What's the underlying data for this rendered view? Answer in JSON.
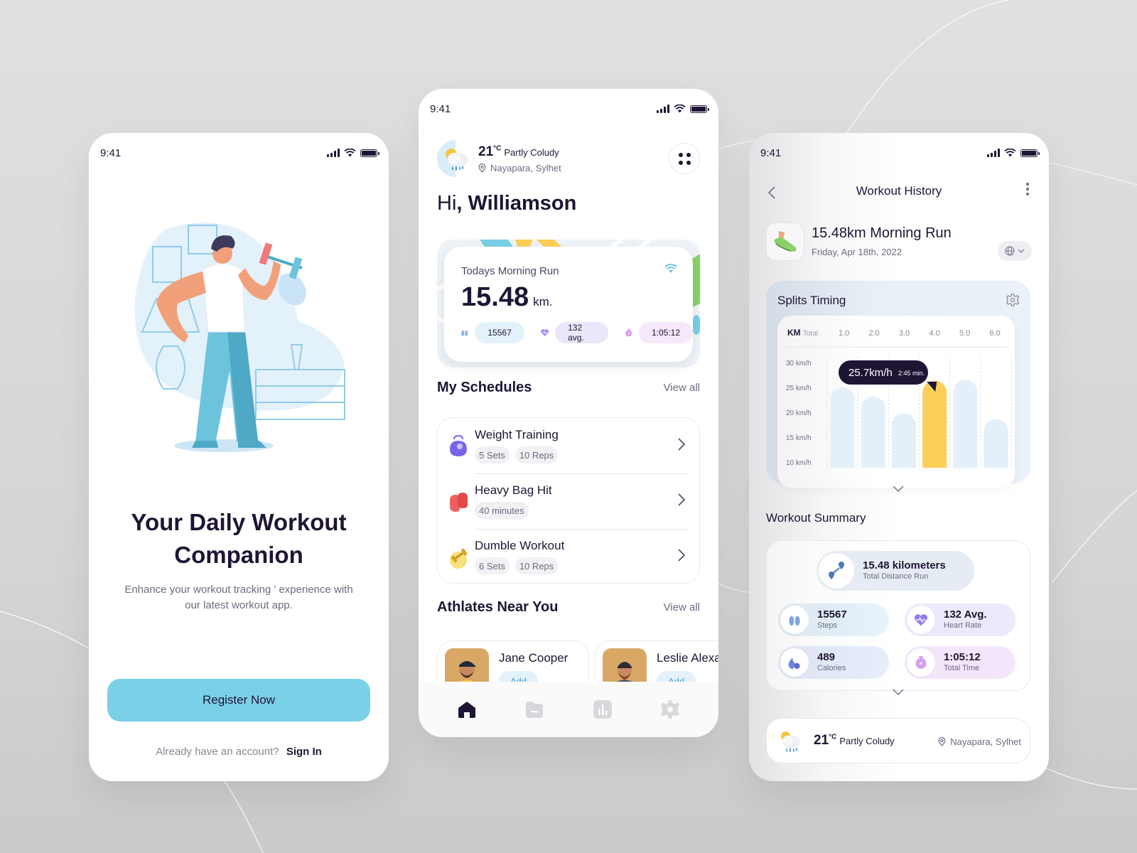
{
  "status_bar": {
    "time": "9:41"
  },
  "onboarding": {
    "title_line1": "Your Daily Workout",
    "title_line2": "Companion",
    "subtitle_line1": "Enhance your workout tracking ' experience with",
    "subtitle_line2": "our latest workout app.",
    "register_button": "Register Now",
    "signin_prompt": "Already have an account?",
    "signin_link": "Sign In"
  },
  "home": {
    "weather": {
      "temp": "21",
      "unit": "°C",
      "condition": "Partly Coludy",
      "location": "Nayapara, Sylhet"
    },
    "greeting_prefix": "Hi",
    "greeting_name": ", Williamson",
    "run_card": {
      "label": "Todays Morning Run",
      "distance": "15.48",
      "unit": "km.",
      "steps": "15567",
      "heart_rate": "132 avg.",
      "duration": "1:05:12"
    },
    "schedules": {
      "title": "My Schedules",
      "view_all": "View all",
      "items": [
        {
          "name": "Weight Training",
          "tags": [
            "5 Sets",
            "10 Reps"
          ],
          "icon": "kettlebell-icon"
        },
        {
          "name": "Heavy Bag Hit",
          "tags": [
            "40 minutes"
          ],
          "icon": "boxing-gloves-icon"
        },
        {
          "name": "Dumble Workout",
          "tags": [
            "6 Sets",
            "10 Reps"
          ],
          "icon": "dumbbell-icon"
        }
      ]
    },
    "athletes": {
      "title": "Athlates Near You",
      "view_all": "View all",
      "items": [
        {
          "name": "Jane Cooper",
          "action": "Add"
        },
        {
          "name": "Leslie Alexander",
          "action": "Add"
        }
      ]
    },
    "tabbar": [
      "home-icon",
      "folder-icon",
      "stats-icon",
      "settings-icon"
    ]
  },
  "history": {
    "title": "Workout History",
    "run_title": "15.48km Morning Run",
    "run_date": "Friday, Apr 18th, 2022",
    "splits": {
      "title": "Splits Timing",
      "tooltip_speed": "25.7km/h",
      "tooltip_time": "2:45 min."
    },
    "summary": {
      "title": "Workout Summary",
      "distance_value": "15.48 kilometers",
      "distance_label": "Total Distance Run",
      "steps_value": "15567",
      "steps_label": "Steps",
      "heart_value": "132 Avg.",
      "heart_label": "Heart Rate",
      "calories_value": "489",
      "calories_label": "Calories",
      "time_value": "1:05:12",
      "time_label": "Total Time"
    },
    "weather": {
      "temp": "21",
      "unit": "°C",
      "condition": "Partly Coludy",
      "location": "Nayapara, Sylhet"
    }
  },
  "chart_data": {
    "type": "bar",
    "title": "Splits Timing",
    "header_label": "KM",
    "header_sub": "Total",
    "categories": [
      "1.0",
      "2.0",
      "3.0",
      "4.0",
      "5.0",
      "6.0"
    ],
    "values": [
      24.5,
      22.5,
      18.8,
      26.0,
      26.2,
      17.5
    ],
    "highlight_index": 3,
    "highlight_color": "#fbcf58",
    "bar_color": "#e3f0fa",
    "yticks": [
      "30 km/h",
      "25 km/h",
      "20 km/h",
      "15 km/h",
      "10 km/h"
    ],
    "ylim": [
      8,
      30
    ],
    "ylabel": "km/h"
  }
}
